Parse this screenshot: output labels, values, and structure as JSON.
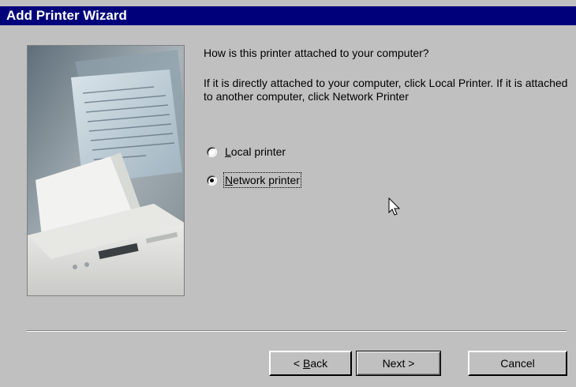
{
  "window": {
    "title": "Add Printer Wizard"
  },
  "content": {
    "question": "How is this printer attached to your computer?",
    "description": "If it is directly attached to your computer, click Local Printer. If it is attached to another computer, click Network Printer"
  },
  "options": [
    {
      "label_first": "L",
      "label_rest": "ocal printer",
      "selected": false
    },
    {
      "label_first": "N",
      "label_rest": "etwork printer",
      "selected": true
    }
  ],
  "buttons": {
    "back_pre": "< ",
    "back_accel": "B",
    "back_rest": "ack",
    "next": "Next >",
    "cancel": "Cancel"
  },
  "colors": {
    "titlebar": "#00007b",
    "face": "#c0c0c0"
  }
}
